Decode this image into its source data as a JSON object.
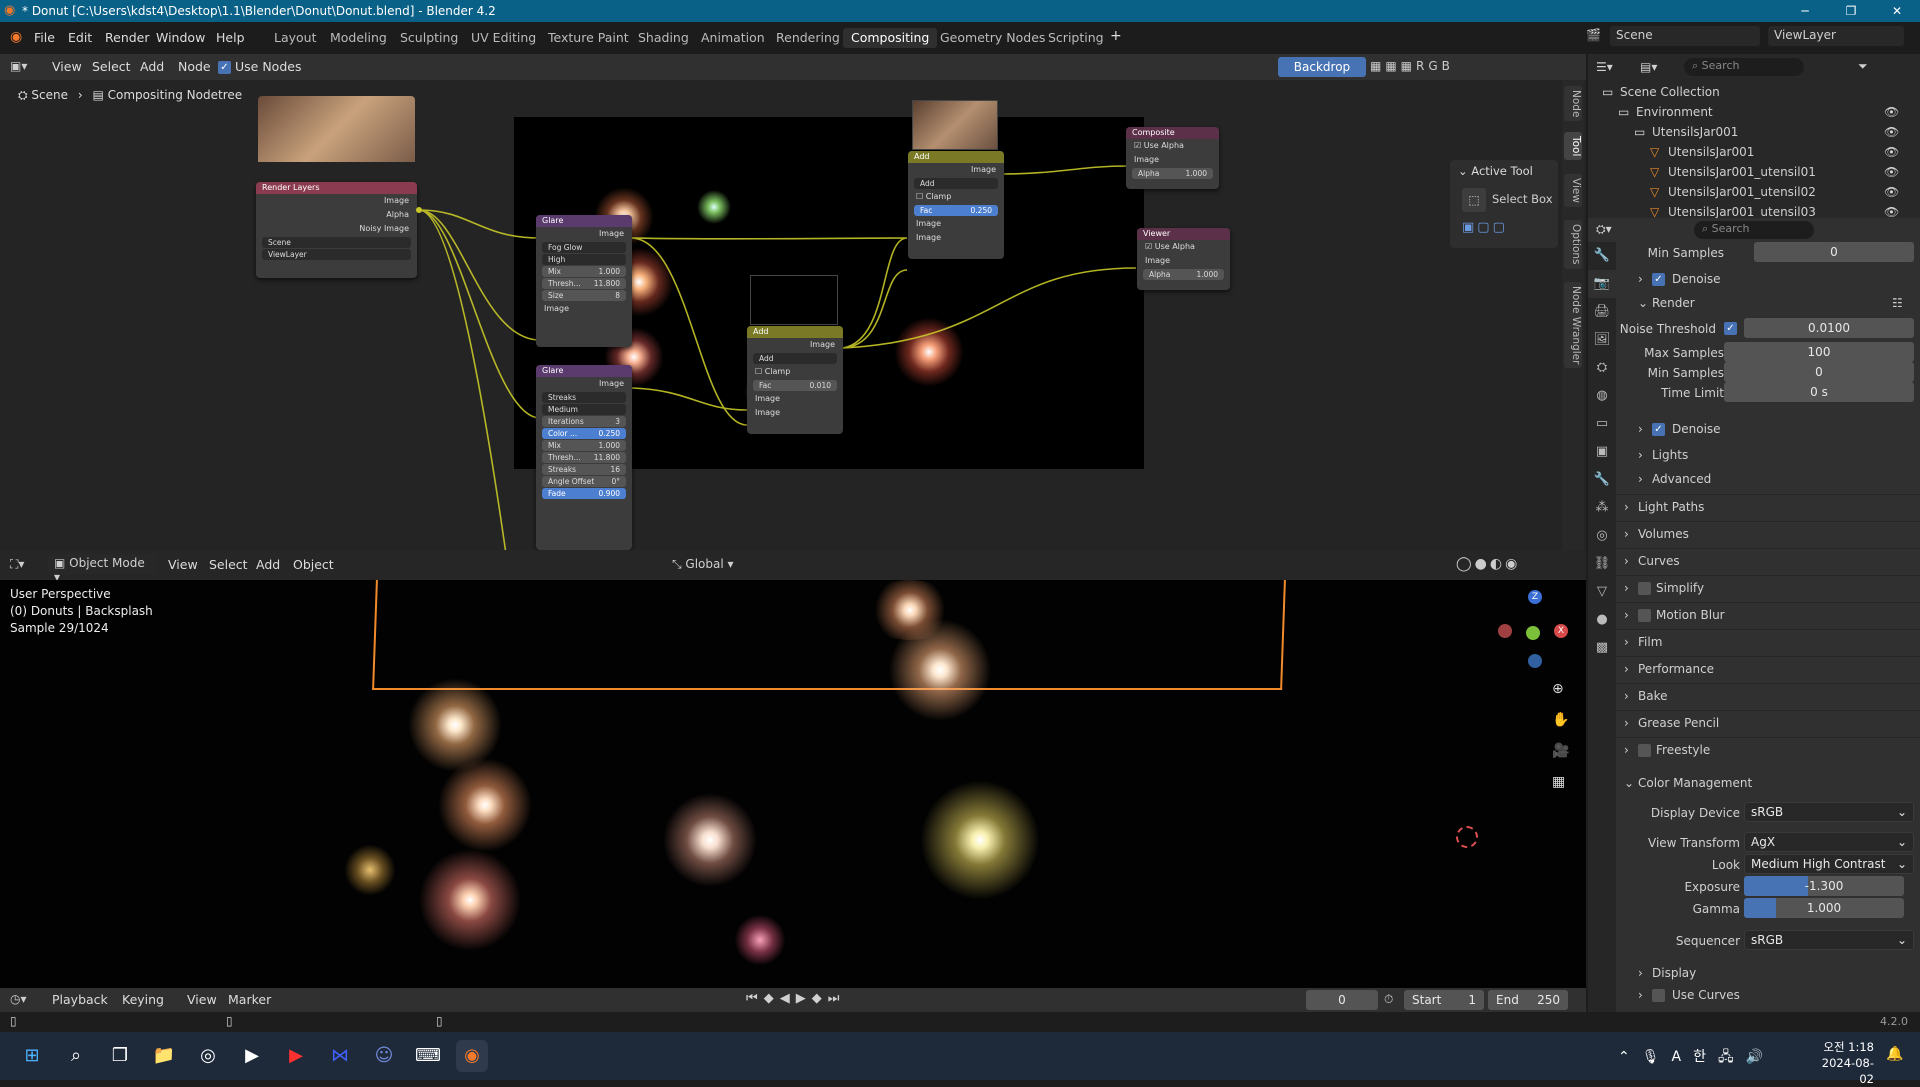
{
  "app": {
    "title": "* Donut [C:\\Users\\kdst4\\Desktop\\1.1\\Blender\\Donut\\Donut.blend] - Blender 4.2"
  },
  "menu": [
    "File",
    "Edit",
    "Render",
    "Window",
    "Help"
  ],
  "workspaces": [
    "Layout",
    "Modeling",
    "Sculpting",
    "UV Editing",
    "Texture Paint",
    "Shading",
    "Animation",
    "Rendering",
    "Compositing",
    "Geometry Nodes",
    "Scripting"
  ],
  "active_workspace": "Compositing",
  "scene": {
    "scene_label": "Scene",
    "viewlayer_label": "ViewLayer"
  },
  "node_header": {
    "items": [
      "View",
      "Select",
      "Add",
      "Node"
    ],
    "use_nodes": "Use Nodes",
    "backdrop": "Backdrop"
  },
  "breadcrumb": {
    "scene": "Scene",
    "tree": "Compositing Nodetree"
  },
  "nodes": {
    "render_layers": {
      "title": "Render Layers",
      "outputs": [
        "Image",
        "Alpha",
        "Noisy Image"
      ],
      "scene": "Scene",
      "viewlayer": "ViewLayer"
    },
    "glare1": {
      "title": "Glare",
      "out": "Image",
      "type": "Fog Glow",
      "quality": "High",
      "mix_label": "Mix",
      "mix": "1.000",
      "thresh_label": "Thresh...",
      "thresh": "11.800",
      "size_label": "Size",
      "size": "8",
      "in": "Image"
    },
    "glare2": {
      "title": "Glare",
      "out": "Image",
      "type": "Streaks",
      "quality": "Medium",
      "iter_label": "Iterations",
      "iter": "3",
      "color_label": "Color ...",
      "color": "0.250",
      "mix_label": "Mix",
      "mix": "1.000",
      "thresh_label": "Thresh...",
      "thresh": "11.800",
      "streaks_label": "Streaks",
      "streaks": "16",
      "angle_label": "Angle Offset",
      "angle": "0°",
      "fade_label": "Fade",
      "fade": "0.900"
    },
    "add1": {
      "title": "Add",
      "out": "Image",
      "blend": "Add",
      "clamp": "Clamp",
      "fac_label": "Fac",
      "fac": "0.010",
      "in1": "Image",
      "in2": "Image"
    },
    "add2": {
      "title": "Add",
      "out": "Image",
      "blend": "Add",
      "clamp": "Clamp",
      "fac_label": "Fac",
      "fac": "0.250",
      "in1": "Image",
      "in2": "Image"
    },
    "composite": {
      "title": "Composite",
      "use_alpha": "Use Alpha",
      "in": "Image",
      "alpha_label": "Alpha",
      "alpha": "1.000"
    },
    "viewer": {
      "title": "Viewer",
      "use_alpha": "Use Alpha",
      "in": "Image",
      "alpha_label": "Alpha",
      "alpha": "1.000"
    }
  },
  "side_tabs": [
    "Node",
    "Tool",
    "View",
    "Options",
    "Node Wrangler"
  ],
  "active_tool": {
    "title": "Active Tool",
    "tool": "Select Box"
  },
  "viewport_header": {
    "mode": "Object Mode",
    "items": [
      "View",
      "Select",
      "Add",
      "Object"
    ],
    "orientation": "Global"
  },
  "viewport_overlay": {
    "line1": "User Perspective",
    "line2": "(0) Donuts | Backsplash",
    "line3": "Sample 29/1024"
  },
  "timeline": {
    "items": [
      "Playback",
      "Keying",
      "View",
      "Marker"
    ],
    "frame": "0",
    "start_label": "Start",
    "start": "1",
    "end_label": "End",
    "end": "250"
  },
  "outliner": {
    "search": "Search",
    "items": [
      {
        "name": "Scene Collection",
        "indent": 0
      },
      {
        "name": "Environment",
        "indent": 1
      },
      {
        "name": "UtensilsJar001",
        "indent": 2
      },
      {
        "name": "UtensilsJar001",
        "indent": 3
      },
      {
        "name": "UtensilsJar001_utensil01",
        "indent": 3
      },
      {
        "name": "UtensilsJar001_utensil02",
        "indent": 3
      },
      {
        "name": "UtensilsJar001_utensil03",
        "indent": 3
      }
    ]
  },
  "properties": {
    "search": "Search",
    "min_samples_top": {
      "label": "Min Samples",
      "value": "0"
    },
    "denoise1": "Denoise",
    "render_panel": "Render",
    "noise_threshold": {
      "label": "Noise Threshold",
      "value": "0.0100"
    },
    "max_samples": {
      "label": "Max Samples",
      "value": "100"
    },
    "min_samples": {
      "label": "Min Samples",
      "value": "0"
    },
    "time_limit": {
      "label": "Time Limit",
      "value": "0 s"
    },
    "denoise2": "Denoise",
    "lights": "Lights",
    "advanced": "Advanced",
    "panels": [
      "Light Paths",
      "Volumes",
      "Curves",
      "Simplify",
      "Motion Blur",
      "Film",
      "Performance",
      "Bake",
      "Grease Pencil",
      "Freestyle"
    ],
    "color_management": "Color Management",
    "display_device": {
      "label": "Display Device",
      "value": "sRGB"
    },
    "view_transform": {
      "label": "View Transform",
      "value": "AgX"
    },
    "look": {
      "label": "Look",
      "value": "Medium High Contrast"
    },
    "exposure": {
      "label": "Exposure",
      "value": "-1.300",
      "fill": 0.4
    },
    "gamma": {
      "label": "Gamma",
      "value": "1.000",
      "fill": 0.2
    },
    "sequencer": {
      "label": "Sequencer",
      "value": "sRGB"
    },
    "display": "Display",
    "use_curves": "Use Curves"
  },
  "status": {
    "version": "4.2.0"
  },
  "taskbar": {
    "time": "오전 1:18",
    "date": "2024-08-02",
    "ime1": "A",
    "ime2": "한"
  }
}
